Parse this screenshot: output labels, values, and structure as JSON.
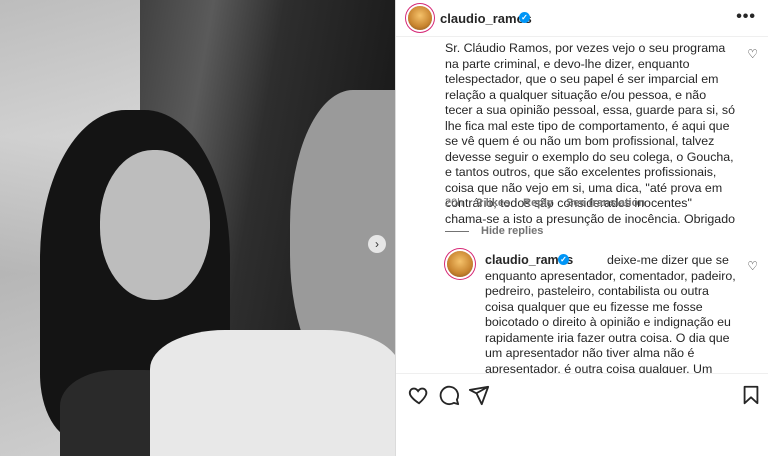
{
  "post_author": {
    "username": "claudio_ramos",
    "verified": true
  },
  "header": {
    "more_label": "•••"
  },
  "comment": {
    "text": "Sr. Cláudio Ramos, por vezes vejo o seu programa na parte criminal, e devo-lhe dizer, enquanto telespectador, que o seu papel é ser imparcial em relação a qualquer situação e/ou pessoa, e não tecer a sua opinião pessoal, essa, guarde para si, só lhe fica mal este tipo de comportamento, é aqui que se vê quem é ou não um bom profissional, talvez devesse seguir o exemplo do seu colega, o Goucha, e tantos outros, que são excelentes profissionais, coisa que não vejo em si, uma dica, \"até prova em contrário, todos são considerados inocentes\" chama-se a isto a presunção de inocência. Obrigado",
    "time": "20h",
    "likes": "2 likes",
    "reply_label": "Reply",
    "translate_label": "See translation",
    "hide_replies_label": "Hide replies"
  },
  "reply": {
    "username": "claudio_ramos",
    "text": "deixe-me dizer que se enquanto apresentador, comentador, padeiro, pedreiro, pasteleiro, contabilista ou outra coisa qualquer que eu fizesse me fosse boicotado o direito à opinião e indignação eu rapidamente iria fazer outra coisa. O dia que um apresentador não tiver alma não é apresentador, é outra coisa qualquer. Um abraço 💚"
  },
  "icons": {
    "like": "heart-outline-icon",
    "comment": "speech-bubble-icon",
    "share": "paper-plane-icon",
    "save": "bookmark-icon",
    "carousel_next": "chevron-right-icon"
  },
  "colors": {
    "verified": "#0095f6",
    "text": "#262626",
    "secondary": "#737373"
  }
}
